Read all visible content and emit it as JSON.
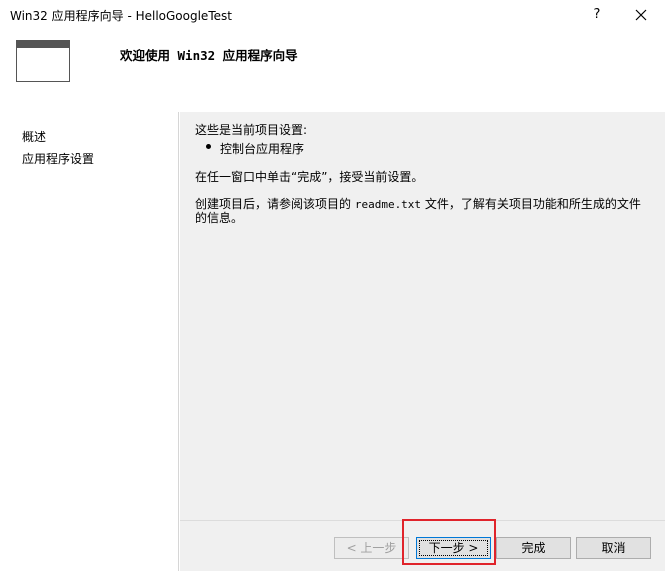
{
  "window": {
    "title": "Win32 应用程序向导 - HelloGoogleTest",
    "help_label": "?"
  },
  "header": {
    "title": "欢迎使用 Win32 应用程序向导"
  },
  "nav": {
    "items": [
      {
        "label": "概述"
      },
      {
        "label": "应用程序设置"
      }
    ]
  },
  "content": {
    "settings_heading": "这些是当前项目设置:",
    "settings_item": "控制台应用程序",
    "instruction": "在任一窗口中单击“完成”，接受当前设置。",
    "readme_before": "创建项目后，请参阅该项目的 ",
    "readme_file": "readme.txt",
    "readme_after": " 文件，了解有关项目功能和所生成的文件",
    "readme_line2": "的信息。"
  },
  "footer": {
    "prev_label": "< 上一步",
    "next_label": "下一步 >",
    "finish_label": "完成",
    "cancel_label": "取消"
  },
  "colors": {
    "highlight": "#e0242b",
    "content_bg": "#f0f0f0",
    "focus_border": "#0078d7"
  }
}
